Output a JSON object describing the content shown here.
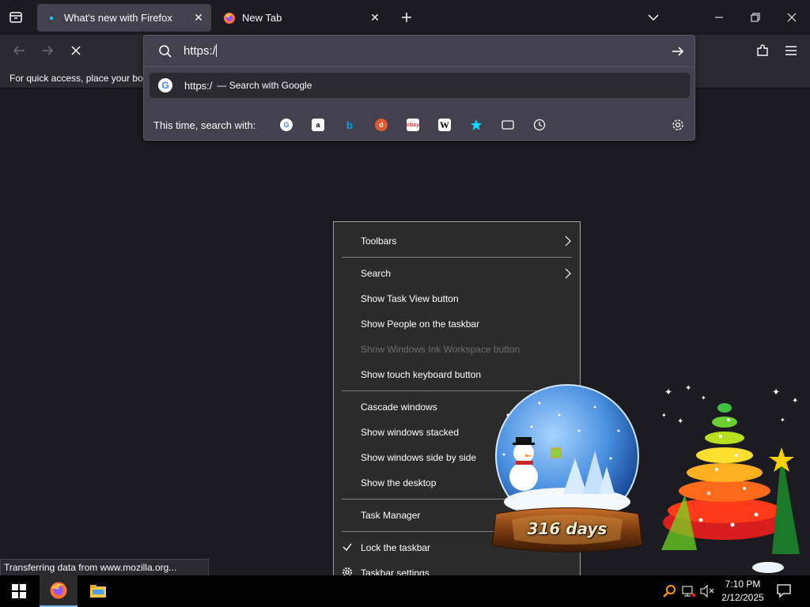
{
  "tabs": [
    {
      "label": "What's new with Firefox",
      "active": true
    },
    {
      "label": "New Tab",
      "active": false
    }
  ],
  "bookmarks_bar": {
    "text": "For quick access, place your boo"
  },
  "urlbar": {
    "value": "https:/",
    "suggestion": {
      "text": "https:/",
      "action": "— Search with Google"
    },
    "one_off_label": "This time, search with:",
    "engines": [
      "google-icon",
      "amazon-icon",
      "bing-icon",
      "duckduckgo-icon",
      "ebay-icon",
      "wikipedia-icon",
      "bookmarks-icon",
      "tabs-icon",
      "history-icon"
    ]
  },
  "context_menu": {
    "items": [
      {
        "label": "Toolbars",
        "submenu": true
      },
      {
        "label": "Search",
        "submenu": true
      },
      {
        "label": "Show Task View button"
      },
      {
        "label": "Show People on the taskbar"
      },
      {
        "label": "Show Windows Ink Workspace button",
        "disabled": true
      },
      {
        "label": "Show touch keyboard button"
      },
      {
        "label": "Cascade windows"
      },
      {
        "label": "Show windows stacked"
      },
      {
        "label": "Show windows side by side"
      },
      {
        "label": "Show the desktop"
      },
      {
        "label": "Task Manager"
      },
      {
        "label": "Lock the taskbar",
        "checked": true
      },
      {
        "label": "Taskbar settings"
      }
    ]
  },
  "status": {
    "text": "Transferring data from www.mozilla.org..."
  },
  "taskbar": {
    "clock_time": "7:10 PM",
    "clock_date": "2/12/2025"
  },
  "widget": {
    "days_label": "316 days"
  },
  "colors": {
    "accent": "#00ddff",
    "taskbar": "#000000",
    "menu_bg": "#2b2b2b"
  }
}
